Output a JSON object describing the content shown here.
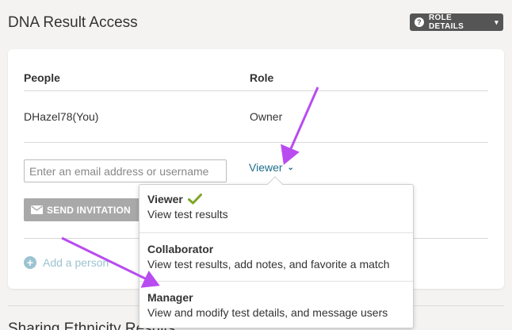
{
  "page": {
    "title": "DNA Result Access",
    "role_details_label": "ROLE DETAILS"
  },
  "table": {
    "headers": {
      "people": "People",
      "role": "Role"
    },
    "rows": [
      {
        "person": "DHazel78(You)",
        "role": "Owner"
      }
    ]
  },
  "invite": {
    "email_placeholder": "Enter an email address or username",
    "email_value": "",
    "selected_role": "Viewer",
    "send_label": "SEND INVITATION",
    "add_person_label": "Add a person"
  },
  "role_menu": {
    "options": [
      {
        "name": "Viewer",
        "description": "View test results",
        "selected": true
      },
      {
        "name": "Collaborator",
        "description": "View test results, add notes, and favorite a match",
        "selected": false
      },
      {
        "name": "Manager",
        "description": "View and modify test details, and message users",
        "selected": false
      }
    ]
  },
  "next_section": {
    "title": "Sharing Ethnicity Results"
  },
  "colors": {
    "link": "#1f6f8b",
    "checkmark": "#7ea628",
    "annotation_arrow": "#b94cf0",
    "button_disabled": "#a9a9a9"
  },
  "icons": {
    "role_details": "question-circle-icon",
    "dropdown_chevron": "chevron-down-icon",
    "send": "envelope-icon",
    "add": "plus-circle-icon",
    "selected": "checkmark-icon"
  }
}
